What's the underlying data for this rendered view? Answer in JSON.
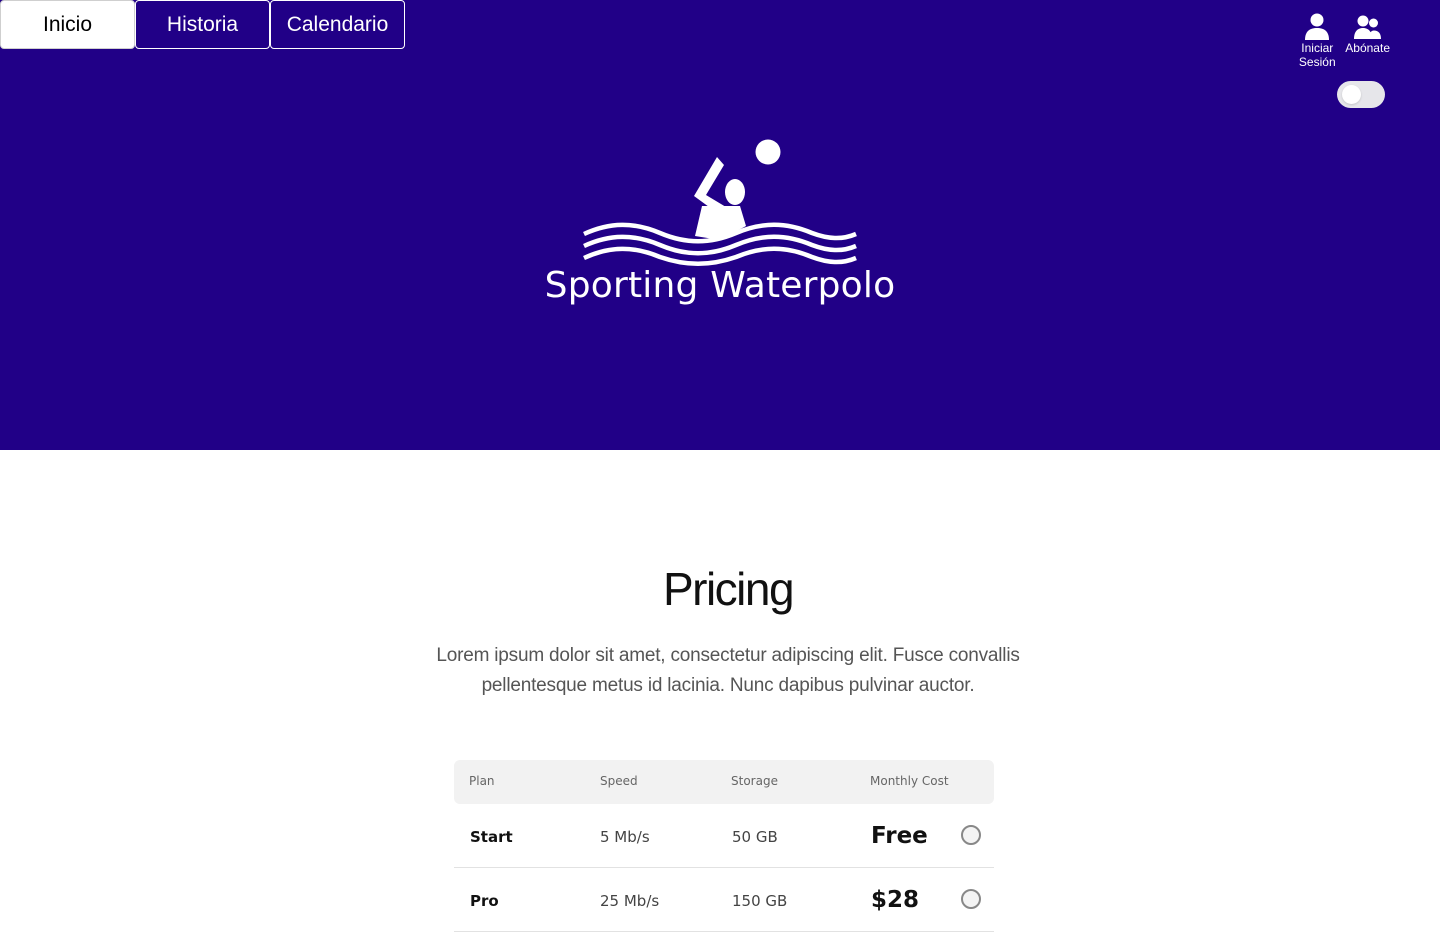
{
  "nav": {
    "tabs": [
      {
        "label": "Inicio",
        "active": true
      },
      {
        "label": "Historia",
        "active": false
      },
      {
        "label": "Calendario",
        "active": false
      }
    ]
  },
  "user_actions": {
    "login_label": "Iniciar Sesión",
    "subscribe_label": "Abónate",
    "login_icon": "user-icon",
    "subscribe_icon": "users-icon"
  },
  "theme_toggle": {
    "on": false
  },
  "logo": {
    "text": "Sporting Waterpolo",
    "icon": "waterpolo-player-icon"
  },
  "pricing": {
    "title": "Pricing",
    "description": "Lorem ipsum dolor sit amet, consectetur adipiscing elit. Fusce convallis pellentesque metus id lacinia. Nunc dapibus pulvinar auctor.",
    "columns": [
      "Plan",
      "Speed",
      "Storage",
      "Monthly Cost"
    ],
    "rows": [
      {
        "plan": "Start",
        "speed": "5 Mb/s",
        "storage": "50 GB",
        "cost": "Free",
        "selected": false
      },
      {
        "plan": "Pro",
        "speed": "25 Mb/s",
        "storage": "150 GB",
        "cost": "$28",
        "selected": false
      }
    ]
  },
  "colors": {
    "hero_background": "#210087",
    "text_primary": "#111111",
    "text_secondary": "#555555"
  }
}
